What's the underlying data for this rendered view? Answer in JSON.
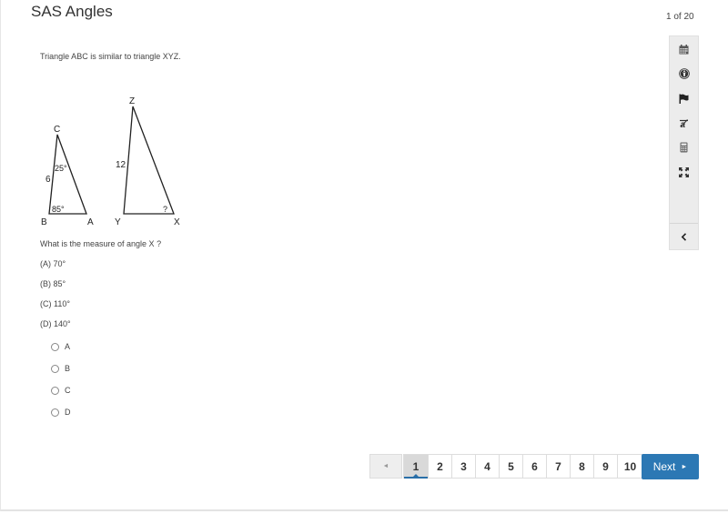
{
  "header": {
    "title": "SAS Angles",
    "counter": "1 of 20"
  },
  "question": {
    "prompt": "Triangle ABC is similar to triangle XYZ.",
    "figure": {
      "triangle_abc": {
        "vertices": [
          "A",
          "B",
          "C"
        ],
        "side_bc": "6",
        "angle_c": "25°",
        "angle_b": "85°"
      },
      "triangle_xyz": {
        "vertices": [
          "X",
          "Y",
          "Z"
        ],
        "side_yz": "12",
        "angle_x": "?"
      }
    },
    "text": "What is the measure of angle X ?",
    "choices": [
      {
        "label": "(A)  70°"
      },
      {
        "label": "(B)  85°"
      },
      {
        "label": "(C)  110°"
      },
      {
        "label": "(D) 140°"
      }
    ],
    "options": [
      {
        "label": "A",
        "selected": false
      },
      {
        "label": "B",
        "selected": false
      },
      {
        "label": "C",
        "selected": false
      },
      {
        "label": "D",
        "selected": false
      }
    ]
  },
  "toolbar": {
    "tools": [
      {
        "name": "calendar-icon"
      },
      {
        "name": "accessibility-icon"
      },
      {
        "name": "flag-icon"
      },
      {
        "name": "strikethrough-icon"
      },
      {
        "name": "calculator-icon"
      },
      {
        "name": "expand-icon"
      }
    ],
    "collapse": {
      "name": "chevron-left-icon"
    }
  },
  "pagination": {
    "prev_label": "◄",
    "pages": [
      "1",
      "2",
      "3",
      "4",
      "5",
      "6",
      "7",
      "8",
      "9",
      "10"
    ],
    "current_page": "1",
    "next_label": "Next",
    "next_arrow": "►"
  },
  "colors": {
    "accent": "#2c78b4",
    "active_page_bg": "#d9d9d9",
    "toolbar_bg": "#ececec"
  }
}
